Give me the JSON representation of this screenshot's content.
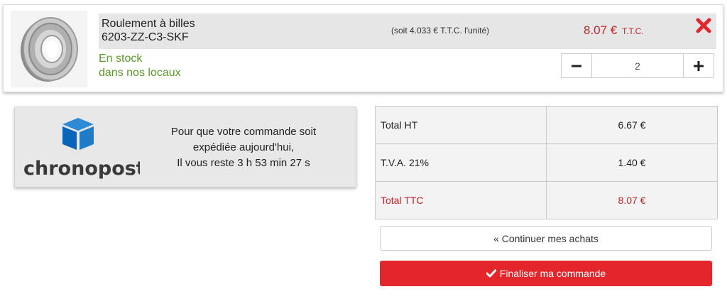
{
  "product": {
    "name_line1": "Roulement à billes",
    "name_line2": "6203-ZZ-C3-SKF",
    "unit_price": "(soit 4.033 € T.T.C. l'unité)",
    "price": "8.07 €",
    "price_suffix": "T.T.C.",
    "stock_line1": "En stock",
    "stock_line2": "dans nos locaux",
    "image_icon": "ball-bearing-image",
    "quantity": "2",
    "remove_icon": "close-icon",
    "colors": {
      "price": "#c0272d",
      "stock": "#5a9a2a",
      "remove": "#e4252b"
    }
  },
  "shipping": {
    "brand_logo_text": "chronopost",
    "line1": "Pour que votre commande soit",
    "line2": "expédiée aujourd'hui,",
    "line3": "Il vous reste 3 h 53 min 27 s"
  },
  "totals": [
    {
      "label": "Total HT",
      "value": "6.67 €"
    },
    {
      "label": "T.V.A. 21%",
      "value": "1.40 €"
    },
    {
      "label": "Total TTC",
      "value": "8.07 €"
    }
  ],
  "actions": {
    "continue_label": "« Continuer mes achats",
    "finalize_label": "Finaliser ma commande",
    "finalize_color": "#e4252b"
  }
}
